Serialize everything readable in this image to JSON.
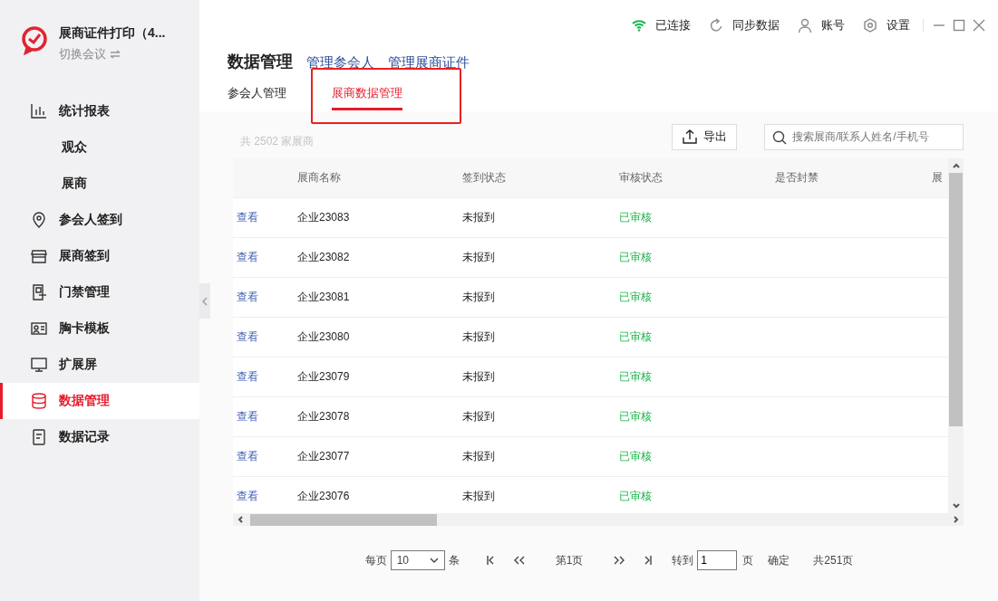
{
  "app": {
    "title": "展商证件打印（4...",
    "switch_label": "切换会议"
  },
  "sidebar": {
    "items": [
      {
        "label": "统计报表",
        "kind": "chart",
        "selected": false,
        "children": [
          {
            "label": "观众",
            "selected": false
          },
          {
            "label": "展商",
            "selected": false
          }
        ]
      },
      {
        "label": "参会人签到",
        "kind": "pin",
        "selected": false
      },
      {
        "label": "展商签到",
        "kind": "store",
        "selected": false
      },
      {
        "label": "门禁管理",
        "kind": "door",
        "selected": false
      },
      {
        "label": "胸卡模板",
        "kind": "card",
        "selected": false
      },
      {
        "label": "扩展屏",
        "kind": "monitor",
        "selected": false
      },
      {
        "label": "数据管理",
        "kind": "db",
        "selected": true
      },
      {
        "label": "数据记录",
        "kind": "doc",
        "selected": false
      }
    ]
  },
  "status": {
    "connection": "已连接",
    "sync": "同步数据",
    "account": "账号",
    "settings": "设置"
  },
  "page": {
    "title": "数据管理",
    "links": [
      "管理参会人",
      "管理展商证件"
    ],
    "tabs": [
      {
        "label": "参会人管理",
        "selected": false,
        "highlighted": false
      },
      {
        "label": "展商数据管理",
        "selected": true,
        "highlighted": true
      }
    ]
  },
  "count": "共 2502 家展商",
  "export_label": "导出",
  "search": {
    "placeholder": "搜索展商/联系人姓名/手机号"
  },
  "table": {
    "columns": [
      "展商名称",
      "签到状态",
      "审核状态",
      "是否封禁",
      "展"
    ],
    "rows": [
      {
        "action": "查看",
        "name": "企业23083",
        "checkin": "未报到",
        "audit": "已审核"
      },
      {
        "action": "查看",
        "name": "企业23082",
        "checkin": "未报到",
        "audit": "已审核"
      },
      {
        "action": "查看",
        "name": "企业23081",
        "checkin": "未报到",
        "audit": "已审核"
      },
      {
        "action": "查看",
        "name": "企业23080",
        "checkin": "未报到",
        "audit": "已审核"
      },
      {
        "action": "查看",
        "name": "企业23079",
        "checkin": "未报到",
        "audit": "已审核"
      },
      {
        "action": "查看",
        "name": "企业23078",
        "checkin": "未报到",
        "audit": "已审核"
      },
      {
        "action": "查看",
        "name": "企业23077",
        "checkin": "未报到",
        "audit": "已审核"
      },
      {
        "action": "查看",
        "name": "企业23076",
        "checkin": "未报到",
        "audit": "已审核"
      }
    ]
  },
  "pagination": {
    "per_page_label": "每页",
    "per_page": "10",
    "unit": "条",
    "current": "第1页",
    "goto_label": "转到",
    "goto_value": "1",
    "page_unit": "页",
    "confirm": "确定",
    "total": "共251页"
  }
}
